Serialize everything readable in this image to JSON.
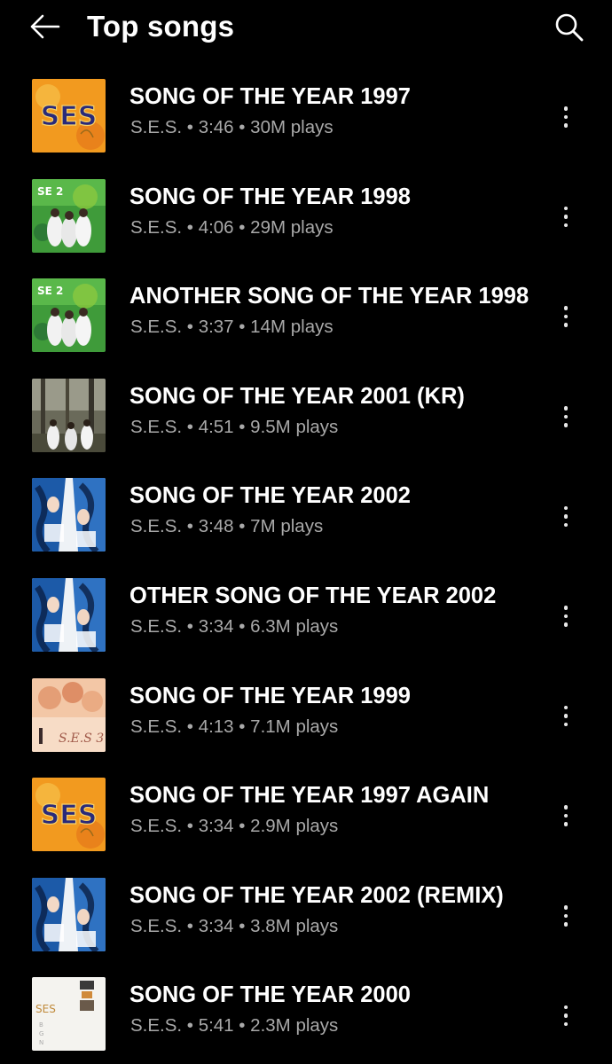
{
  "header": {
    "title": "Top songs",
    "back_icon": "arrow-left-icon",
    "search_icon": "search-icon"
  },
  "songs": [
    {
      "title": "SONG OF THE YEAR 1997",
      "artist": "S.E.S.",
      "duration": "3:46",
      "plays": "30M plays",
      "art": "orange",
      "art_text": "SES"
    },
    {
      "title": "SONG OF THE YEAR 1998",
      "artist": "S.E.S.",
      "duration": "4:06",
      "plays": "29M plays",
      "art": "green",
      "art_text": "SE 2"
    },
    {
      "title": "ANOTHER SONG OF THE YEAR 1998",
      "artist": "S.E.S.",
      "duration": "3:37",
      "plays": "14M plays",
      "art": "green",
      "art_text": "SE 2"
    },
    {
      "title": "SONG OF THE YEAR 2001 (KR)",
      "artist": "S.E.S.",
      "duration": "4:51",
      "plays": "9.5M plays",
      "art": "forest",
      "art_text": ""
    },
    {
      "title": "SONG OF THE YEAR 2002",
      "artist": "S.E.S.",
      "duration": "3:48",
      "plays": "7M plays",
      "art": "blue",
      "art_text": ""
    },
    {
      "title": "OTHER SONG OF THE YEAR 2002",
      "artist": "S.E.S.",
      "duration": "3:34",
      "plays": "6.3M plays",
      "art": "blue",
      "art_text": ""
    },
    {
      "title": "SONG OF THE YEAR 1999",
      "artist": "S.E.S.",
      "duration": "4:13",
      "plays": "7.1M plays",
      "art": "peach",
      "art_text": "S.E.S 3"
    },
    {
      "title": "SONG OF THE YEAR 1997 AGAIN",
      "artist": "S.E.S.",
      "duration": "3:34",
      "plays": "2.9M plays",
      "art": "orange",
      "art_text": "SES"
    },
    {
      "title": "SONG OF THE YEAR 2002 (REMIX)",
      "artist": "S.E.S.",
      "duration": "3:34",
      "plays": "3.8M plays",
      "art": "blue",
      "art_text": ""
    },
    {
      "title": "SONG OF THE YEAR 2000",
      "artist": "S.E.S.",
      "duration": "5:41",
      "plays": "2.3M plays",
      "art": "white",
      "art_text": "SES"
    }
  ],
  "meta_separator": " • ",
  "more_icon": "more-vertical-icon",
  "colors": {
    "background": "#000000",
    "title_text": "#ffffff",
    "meta_text": "#a9a9a9"
  }
}
